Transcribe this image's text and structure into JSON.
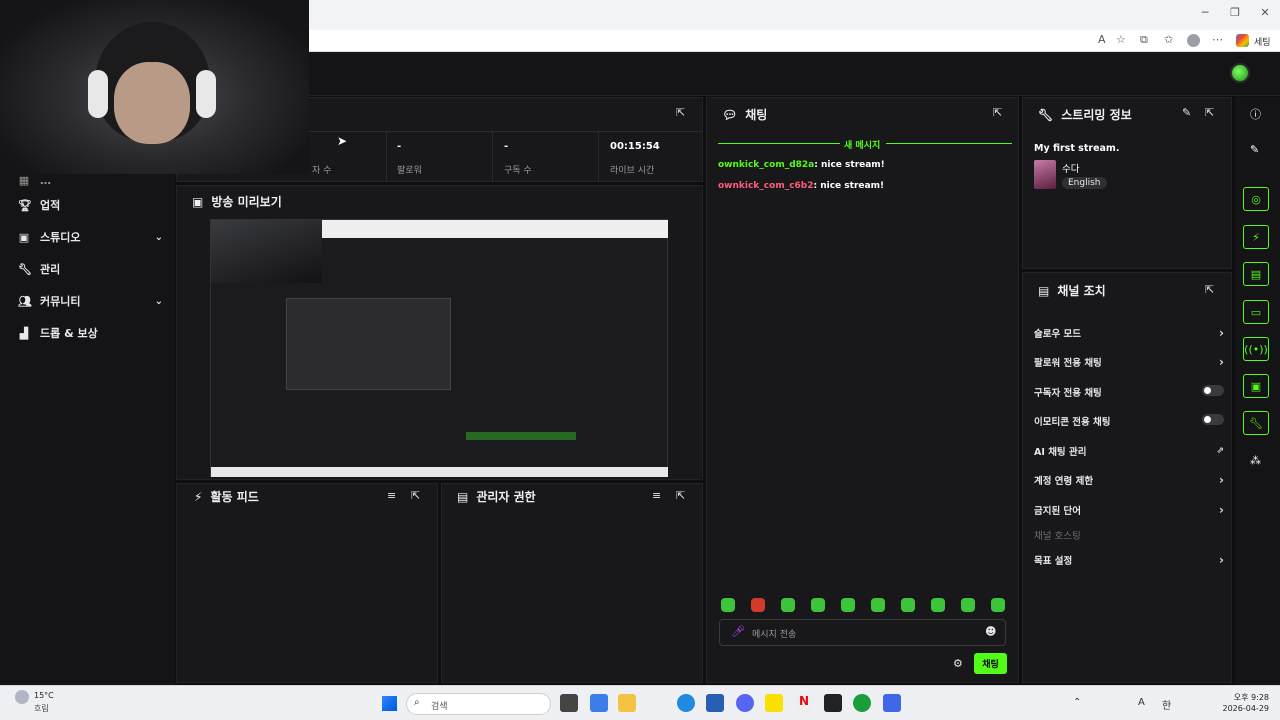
{
  "browser": {
    "profile_label": "세팅",
    "window_buttons": [
      "─",
      "❐",
      "✕"
    ]
  },
  "stats": {
    "items": [
      {
        "value": "",
        "label": "자 수"
      },
      {
        "value": "-",
        "label": "팔로워"
      },
      {
        "value": "-",
        "label": "구독 수"
      },
      {
        "value": "00:15:54",
        "label": "라이브 시간"
      }
    ]
  },
  "sidebar": {
    "items": [
      {
        "label": "업적",
        "icon": "trophy-icon"
      },
      {
        "label": "스튜디오",
        "icon": "studio-icon"
      },
      {
        "label": "관리",
        "icon": "wrench-icon"
      },
      {
        "label": "커뮤니티",
        "icon": "community-icon"
      },
      {
        "label": "드롭 & 보상",
        "icon": "chart-icon"
      }
    ]
  },
  "preview": {
    "title": "방송 미리보기"
  },
  "activity": {
    "title": "활동 피드"
  },
  "mods": {
    "title": "관리자 권한"
  },
  "chat": {
    "title": "채팅",
    "new_messages": "새 메시지",
    "messages": [
      {
        "user": "ownkick_com_d82a",
        "text": ": nice stream!",
        "color": "#53fc18"
      },
      {
        "user": "ownkick_com_c6b2",
        "text": ": nice stream!",
        "color": "#ff5c7a"
      }
    ],
    "placeholder": "메시지 전송",
    "send_label": "채팅"
  },
  "stream_info": {
    "title": "스트리밍 정보",
    "stream_title": "My first stream.",
    "category": "수다",
    "language": "English"
  },
  "channel_actions": {
    "title": "채널 조치",
    "options": [
      {
        "label": "슬로우 모드",
        "control": "chevron"
      },
      {
        "label": "팔로워 전용 채팅",
        "control": "chevron"
      },
      {
        "label": "구독자 전용 채팅",
        "control": "toggle"
      },
      {
        "label": "이모티콘 전용 채팅",
        "control": "toggle"
      },
      {
        "label": "AI 채팅 관리",
        "control": "external"
      },
      {
        "label": "계정 연령 제한",
        "control": "chevron"
      },
      {
        "label": "금지된 단어",
        "control": "chevron"
      },
      {
        "label": "채널 호스팅",
        "control": "none"
      },
      {
        "label": "목표 설정",
        "control": "chevron"
      }
    ]
  },
  "taskbar": {
    "weather_temp": "15°C",
    "weather_desc": "흐림",
    "search_placeholder": "검색",
    "time": "오후 9:28",
    "date": "2026-04-29",
    "lang": "A",
    "ime": "한"
  },
  "colors": {
    "accent": "#53fc18",
    "panel": "#18181b",
    "bg": "#0e0e10"
  }
}
